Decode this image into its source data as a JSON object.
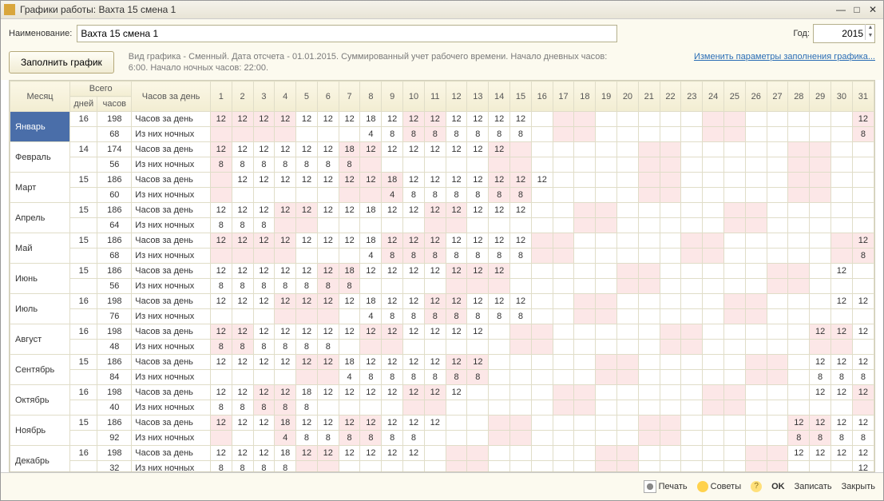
{
  "window_title": "Графики работы: Вахта 15 смена 1",
  "labels": {
    "name": "Наименование:",
    "year": "Год:",
    "fill": "Заполнить график",
    "desc": "Вид графика - Сменный. Дата отсчета - 01.01.2015. Суммированный учет рабочего времени. Начало дневных часов: 6:00. Начало ночных часов: 22:00.",
    "link": "Изменить параметры заполнения графика...",
    "month": "Месяц",
    "total": "Всего",
    "days": "дней",
    "hours": "часов",
    "perday": "Часов за день",
    "hrs_day": "Часов за день",
    "hrs_night": "Из них ночных",
    "print": "Печать",
    "tips": "Советы",
    "ok": "OK",
    "save": "Записать",
    "close": "Закрыть"
  },
  "name_value": "Вахта 15 смена 1",
  "year_value": "2015",
  "day_headers": [
    "1",
    "2",
    "3",
    "4",
    "5",
    "6",
    "7",
    "8",
    "9",
    "10",
    "11",
    "12",
    "13",
    "14",
    "15",
    "16",
    "17",
    "18",
    "19",
    "20",
    "21",
    "22",
    "23",
    "24",
    "25",
    "26",
    "27",
    "28",
    "29",
    "30",
    "31"
  ],
  "months": [
    {
      "name": "Январь",
      "days": 16,
      "hours": 198,
      "night_total": 68,
      "hrs": [
        "12",
        "12",
        "12",
        "12",
        "12",
        "12",
        "12",
        "18",
        "12",
        "12",
        "12",
        "12",
        "12",
        "12",
        "12",
        "",
        "",
        "",
        "",
        "",
        "",
        "",
        "",
        "",
        "",
        "",
        "",
        "",
        "",
        "",
        "12"
      ],
      "nt": [
        "",
        "",
        "",
        "",
        "",
        "",
        "",
        "4",
        "8",
        "8",
        "8",
        "8",
        "8",
        "8",
        "8",
        "",
        "",
        "",
        "",
        "",
        "",
        "",
        "",
        "",
        "",
        "",
        "",
        "",
        "",
        "",
        "8"
      ],
      "we": [
        0,
        1,
        2,
        3,
        9,
        10,
        16,
        17,
        23,
        24,
        30
      ],
      "sel": true
    },
    {
      "name": "Февраль",
      "days": 14,
      "hours": 174,
      "night_total": 56,
      "hrs": [
        "12",
        "12",
        "12",
        "12",
        "12",
        "12",
        "18",
        "12",
        "12",
        "12",
        "12",
        "12",
        "12",
        "12",
        "",
        "",
        "",
        "",
        "",
        "",
        "",
        "",
        "",
        "",
        "",
        "",
        "",
        "",
        "",
        "",
        ""
      ],
      "nt": [
        "8",
        "8",
        "8",
        "8",
        "8",
        "8",
        "8",
        "",
        "",
        "",
        "",
        "",
        "",
        "",
        "",
        "",
        "",
        "",
        "",
        "",
        "",
        "",
        "",
        "",
        "",
        "",
        "",
        "",
        "",
        "",
        ""
      ],
      "we": [
        0,
        6,
        7,
        13,
        14,
        20,
        21,
        27,
        28
      ]
    },
    {
      "name": "Март",
      "days": 15,
      "hours": 186,
      "night_total": 60,
      "hrs": [
        "",
        "12",
        "12",
        "12",
        "12",
        "12",
        "12",
        "12",
        "18",
        "12",
        "12",
        "12",
        "12",
        "12",
        "12",
        "12",
        "",
        "",
        "",
        "",
        "",
        "",
        "",
        "",
        "",
        "",
        "",
        "",
        "",
        "",
        ""
      ],
      "nt": [
        "",
        "",
        "",
        "",
        "",
        "",
        "",
        "",
        "4",
        "8",
        "8",
        "8",
        "8",
        "8",
        "8",
        "",
        "",
        "",
        "",
        "",
        "",
        "",
        "",
        "",
        "",
        "",
        "",
        "",
        "",
        "",
        ""
      ],
      "we": [
        0,
        6,
        7,
        8,
        13,
        14,
        20,
        21,
        27,
        28
      ]
    },
    {
      "name": "Апрель",
      "days": 15,
      "hours": 186,
      "night_total": 64,
      "hrs": [
        "12",
        "12",
        "12",
        "12",
        "12",
        "12",
        "12",
        "18",
        "12",
        "12",
        "12",
        "12",
        "12",
        "12",
        "12",
        "",
        "",
        "",
        "",
        "",
        "",
        "",
        "",
        "",
        "",
        "",
        "",
        "",
        "",
        "",
        ""
      ],
      "nt": [
        "8",
        "8",
        "8",
        "",
        "",
        "",
        "",
        "",
        "",
        "",
        "",
        "",
        "",
        "",
        "",
        "",
        "",
        "",
        "",
        "",
        "",
        "",
        "",
        "",
        "",
        "",
        "",
        "",
        "",
        "",
        ""
      ],
      "we": [
        3,
        4,
        10,
        11,
        17,
        18,
        24,
        25
      ]
    },
    {
      "name": "Май",
      "days": 15,
      "hours": 186,
      "night_total": 68,
      "hrs": [
        "12",
        "12",
        "12",
        "12",
        "12",
        "12",
        "12",
        "18",
        "12",
        "12",
        "12",
        "12",
        "12",
        "12",
        "12",
        "",
        "",
        "",
        "",
        "",
        "",
        "",
        "",
        "",
        "",
        "",
        "",
        "",
        "",
        "",
        "12"
      ],
      "nt": [
        "",
        "",
        "",
        "",
        "",
        "",
        "",
        "4",
        "8",
        "8",
        "8",
        "8",
        "8",
        "8",
        "8",
        "",
        "",
        "",
        "",
        "",
        "",
        "",
        "",
        "",
        "",
        "",
        "",
        "",
        "",
        "",
        "8"
      ],
      "we": [
        0,
        1,
        2,
        3,
        8,
        9,
        10,
        15,
        16,
        22,
        23,
        29,
        30
      ]
    },
    {
      "name": "Июнь",
      "days": 15,
      "hours": 186,
      "night_total": 56,
      "hrs": [
        "12",
        "12",
        "12",
        "12",
        "12",
        "12",
        "18",
        "12",
        "12",
        "12",
        "12",
        "12",
        "12",
        "12",
        "",
        "",
        "",
        "",
        "",
        "",
        "",
        "",
        "",
        "",
        "",
        "",
        "",
        "",
        "",
        "12",
        ""
      ],
      "nt": [
        "8",
        "8",
        "8",
        "8",
        "8",
        "8",
        "8",
        "",
        "",
        "",
        "",
        "",
        "",
        "",
        "",
        "",
        "",
        "",
        "",
        "",
        "",
        "",
        "",
        "",
        "",
        "",
        "",
        "",
        "",
        "",
        ""
      ],
      "we": [
        5,
        6,
        11,
        12,
        13,
        19,
        20,
        26,
        27
      ]
    },
    {
      "name": "Июль",
      "days": 16,
      "hours": 198,
      "night_total": 76,
      "hrs": [
        "12",
        "12",
        "12",
        "12",
        "12",
        "12",
        "12",
        "18",
        "12",
        "12",
        "12",
        "12",
        "12",
        "12",
        "12",
        "",
        "",
        "",
        "",
        "",
        "",
        "",
        "",
        "",
        "",
        "",
        "",
        "",
        "",
        "12",
        "12"
      ],
      "nt": [
        "",
        "",
        "",
        "",
        "",
        "",
        "",
        "4",
        "8",
        "8",
        "8",
        "8",
        "8",
        "8",
        "8",
        "",
        "",
        "",
        "",
        "",
        "",
        "",
        "",
        "",
        "",
        "",
        "",
        "",
        "",
        "",
        ""
      ],
      "we": [
        3,
        4,
        5,
        10,
        11,
        17,
        18,
        24,
        25,
        31
      ]
    },
    {
      "name": "Август",
      "days": 16,
      "hours": 198,
      "night_total": 48,
      "hrs": [
        "12",
        "12",
        "12",
        "12",
        "12",
        "12",
        "12",
        "12",
        "12",
        "12",
        "12",
        "12",
        "12",
        "",
        "",
        "",
        "",
        "",
        "",
        "",
        "",
        "",
        "",
        "",
        "",
        "",
        "",
        "",
        "12",
        "12",
        "12"
      ],
      "nt": [
        "8",
        "8",
        "8",
        "8",
        "8",
        "8",
        "",
        "",
        "",
        "",
        "",
        "",
        "",
        "",
        "",
        "",
        "",
        "",
        "",
        "",
        "",
        "",
        "",
        "",
        "",
        "",
        "",
        "",
        "",
        "",
        ""
      ],
      "we": [
        0,
        1,
        7,
        8,
        14,
        15,
        21,
        22,
        28,
        29
      ]
    },
    {
      "name": "Сентябрь",
      "days": 15,
      "hours": 186,
      "night_total": 84,
      "hrs": [
        "12",
        "12",
        "12",
        "12",
        "12",
        "12",
        "18",
        "12",
        "12",
        "12",
        "12",
        "12",
        "12",
        "",
        "",
        "",
        "",
        "",
        "",
        "",
        "",
        "",
        "",
        "",
        "",
        "",
        "",
        "",
        "12",
        "12",
        "12"
      ],
      "nt": [
        "",
        "",
        "",
        "",
        "",
        "",
        "4",
        "8",
        "8",
        "8",
        "8",
        "8",
        "8",
        "",
        "",
        "",
        "",
        "",
        "",
        "",
        "",
        "",
        "",
        "",
        "",
        "",
        "",
        "",
        "8",
        "8",
        "8"
      ],
      "we": [
        4,
        5,
        11,
        12,
        18,
        19,
        25,
        26
      ]
    },
    {
      "name": "Октябрь",
      "days": 16,
      "hours": 198,
      "night_total": 40,
      "hrs": [
        "12",
        "12",
        "12",
        "12",
        "18",
        "12",
        "12",
        "12",
        "12",
        "12",
        "12",
        "12",
        "",
        "",
        "",
        "",
        "",
        "",
        "",
        "",
        "",
        "",
        "",
        "",
        "",
        "",
        "",
        "",
        "12",
        "12",
        "12"
      ],
      "nt": [
        "8",
        "8",
        "8",
        "8",
        "8",
        "",
        "",
        "",
        "",
        "",
        "",
        "",
        "",
        "",
        "",
        "",
        "",
        "",
        "",
        "",
        "",
        "",
        "",
        "",
        "",
        "",
        "",
        "",
        "",
        "",
        ""
      ],
      "we": [
        2,
        3,
        9,
        10,
        16,
        17,
        23,
        24,
        30,
        31
      ]
    },
    {
      "name": "Ноябрь",
      "days": 15,
      "hours": 186,
      "night_total": 92,
      "hrs": [
        "12",
        "12",
        "12",
        "18",
        "12",
        "12",
        "12",
        "12",
        "12",
        "12",
        "12",
        "",
        "",
        "",
        "",
        "",
        "",
        "",
        "",
        "",
        "",
        "",
        "",
        "",
        "",
        "",
        "",
        "12",
        "12",
        "12",
        "12"
      ],
      "nt": [
        "",
        "",
        "",
        "4",
        "8",
        "8",
        "8",
        "8",
        "8",
        "8",
        "",
        "",
        "",
        "",
        "",
        "",
        "",
        "",
        "",
        "",
        "",
        "",
        "",
        "",
        "",
        "",
        "",
        "8",
        "8",
        "8",
        "8"
      ],
      "we": [
        0,
        3,
        6,
        7,
        13,
        14,
        20,
        21,
        27,
        28
      ]
    },
    {
      "name": "Декабрь",
      "days": 16,
      "hours": 198,
      "night_total": 32,
      "hrs": [
        "12",
        "12",
        "12",
        "18",
        "12",
        "12",
        "12",
        "12",
        "12",
        "12",
        "",
        "",
        "",
        "",
        "",
        "",
        "",
        "",
        "",
        "",
        "",
        "",
        "",
        "",
        "",
        "",
        "",
        "12",
        "12",
        "12",
        "12"
      ],
      "nt": [
        "8",
        "8",
        "8",
        "8",
        "",
        "",
        "",
        "",
        "",
        "",
        "",
        "",
        "",
        "",
        "",
        "",
        "",
        "",
        "",
        "",
        "",
        "",
        "",
        "",
        "",
        "",
        "",
        "",
        "",
        "",
        "12"
      ],
      "we": [
        4,
        5,
        11,
        12,
        18,
        19,
        25,
        26
      ]
    }
  ]
}
